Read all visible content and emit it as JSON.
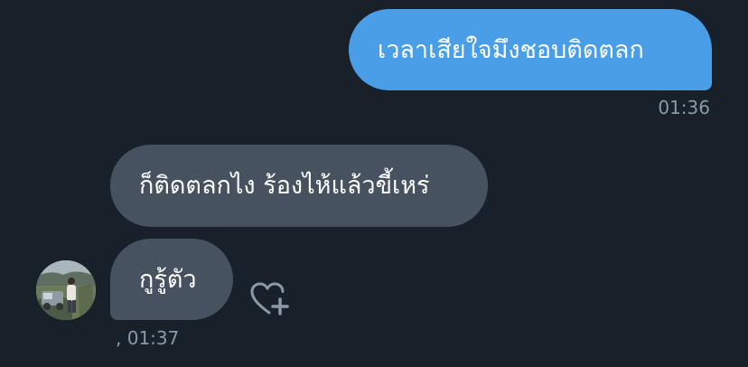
{
  "messages": [
    {
      "direction": "outgoing",
      "text": "เวลาเสียใจมึงชอบติดตลก",
      "time": "01:36"
    },
    {
      "direction": "incoming",
      "text": "ก็ติดตลกไง ร้องไห้แล้วขี้เหร่"
    },
    {
      "direction": "incoming",
      "text": "กูรู้ตัว",
      "time": ", 01:37"
    }
  ],
  "icons": {
    "reaction": "heart-plus-icon",
    "avatar": "contact-avatar"
  },
  "colors": {
    "background": "#18202a",
    "outgoing_bubble": "#4a9ee8",
    "incoming_bubble": "#465260",
    "timestamp": "#8b98a5"
  }
}
